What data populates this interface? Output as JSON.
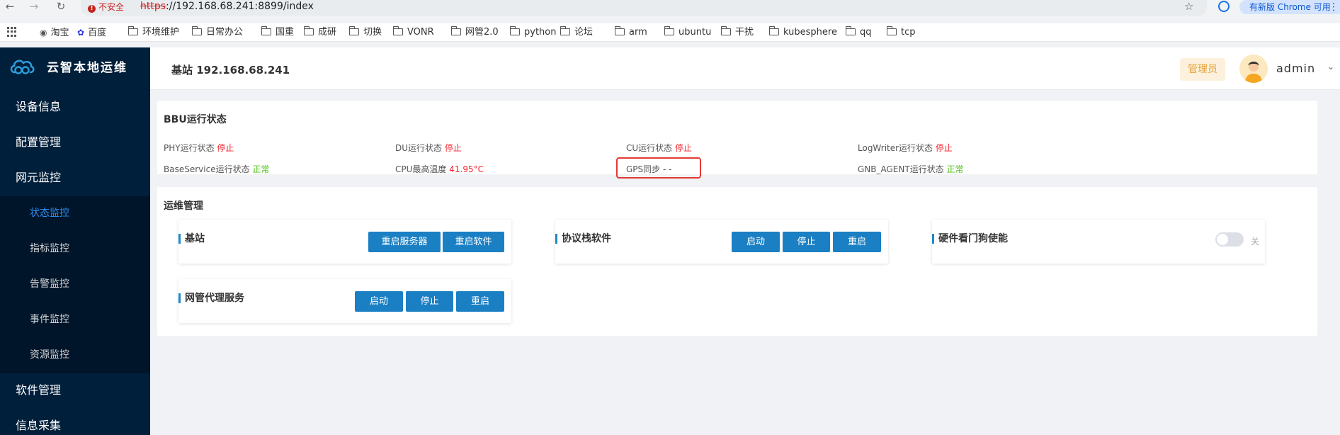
{
  "browser": {
    "insecure_label": "不安全",
    "url_scheme": "https",
    "url_rest": "://192.168.68.241:8899/index",
    "update_label": "有新版 Chrome 可用"
  },
  "bookmarks": [
    {
      "label": "淘宝",
      "icon": "globe-icon"
    },
    {
      "label": "百度",
      "icon": "baidu-paw-icon"
    },
    {
      "label": "环境维护",
      "icon": "folder-icon"
    },
    {
      "label": "日常办公",
      "icon": "folder-icon"
    },
    {
      "label": "国重",
      "icon": "folder-icon"
    },
    {
      "label": "成研",
      "icon": "folder-icon"
    },
    {
      "label": "切换",
      "icon": "folder-icon"
    },
    {
      "label": "VONR",
      "icon": "folder-icon"
    },
    {
      "label": "网管2.0",
      "icon": "folder-icon"
    },
    {
      "label": "python",
      "icon": "folder-icon"
    },
    {
      "label": "论坛",
      "icon": "folder-icon"
    },
    {
      "label": "arm",
      "icon": "folder-icon"
    },
    {
      "label": "ubuntu",
      "icon": "folder-icon"
    },
    {
      "label": "干扰",
      "icon": "folder-icon"
    },
    {
      "label": "kubesphere",
      "icon": "folder-icon"
    },
    {
      "label": "qq",
      "icon": "folder-icon"
    },
    {
      "label": "tcp",
      "icon": "folder-icon"
    }
  ],
  "app": {
    "title": "云智本地运维"
  },
  "sidebar": {
    "items": [
      {
        "label": "设备信息"
      },
      {
        "label": "配置管理"
      },
      {
        "label": "网元监控"
      },
      {
        "label": "软件管理"
      },
      {
        "label": "信息采集"
      }
    ],
    "sub_items": [
      {
        "label": "状态监控",
        "active": true
      },
      {
        "label": "指标监控"
      },
      {
        "label": "告警监控"
      },
      {
        "label": "事件监控"
      },
      {
        "label": "资源监控"
      }
    ]
  },
  "header": {
    "title": "基站 192.168.68.241",
    "role": "管理员",
    "username": "admin"
  },
  "bbu": {
    "title": "BBU运行状态",
    "stats": [
      {
        "label": "PHY运行状态",
        "value": "停止",
        "status": "bad"
      },
      {
        "label": "DU运行状态",
        "value": "停止",
        "status": "bad"
      },
      {
        "label": "CU运行状态",
        "value": "停止",
        "status": "bad"
      },
      {
        "label": "LogWriter运行状态",
        "value": "停止",
        "status": "bad"
      },
      {
        "label": "BaseService运行状态",
        "value": "正常",
        "status": "ok"
      },
      {
        "label": "CPU最高温度",
        "value": "41.95°C",
        "status": "bad"
      },
      {
        "label": "GPS同步",
        "value": "- -",
        "status": "none"
      },
      {
        "label": "GNB_AGENT运行状态",
        "value": "正常",
        "status": "ok"
      }
    ]
  },
  "ops": {
    "title": "运维管理",
    "base_station": {
      "label": "基站",
      "btn_restart_server": "重启服务器",
      "btn_restart_software": "重启软件"
    },
    "protocol": {
      "label": "协议栈软件",
      "btn_start": "启动",
      "btn_stop": "停止",
      "btn_restart": "重启"
    },
    "watchdog": {
      "label": "硬件看门狗使能",
      "toggle_label": "关",
      "enabled": false
    },
    "proxy": {
      "label": "网管代理服务",
      "btn_start": "启动",
      "btn_stop": "停止",
      "btn_restart": "重启"
    }
  },
  "colors": {
    "sidebar_bg": "#001f3a",
    "accent": "#1b7fc4",
    "status_bad": "#f5222d",
    "status_ok": "#52c41a",
    "role_tag": "#e6a23c"
  }
}
